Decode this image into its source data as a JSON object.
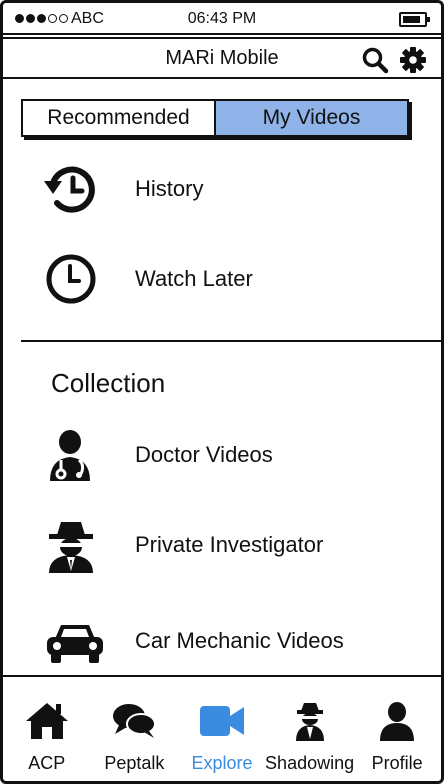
{
  "status_bar": {
    "carrier": "ABC",
    "time": "06:43 PM"
  },
  "header": {
    "title": "MARi Mobile",
    "search_icon": "search-icon",
    "settings_icon": "gear-icon"
  },
  "tabs": [
    {
      "label": "Recommended",
      "active": false
    },
    {
      "label": "My Videos",
      "active": true
    }
  ],
  "my_videos": [
    {
      "label": "History",
      "icon": "history-icon"
    },
    {
      "label": "Watch Later",
      "icon": "clock-icon"
    }
  ],
  "collection": {
    "title": "Collection",
    "items": [
      {
        "label": "Doctor Videos",
        "icon": "doctor-icon"
      },
      {
        "label": "Private Investigator",
        "icon": "detective-icon"
      },
      {
        "label": "Car Mechanic Videos",
        "icon": "car-icon"
      }
    ]
  },
  "bottom_nav": [
    {
      "label": "ACP",
      "icon": "home-icon"
    },
    {
      "label": "Peptalk",
      "icon": "chat-icon"
    },
    {
      "label": "Explore",
      "icon": "video-camera-icon",
      "active": true
    },
    {
      "label": "Shadowing",
      "icon": "detective-icon"
    },
    {
      "label": "Profile",
      "icon": "user-icon"
    }
  ],
  "colors": {
    "accent": "#3a8ce0",
    "tab_active": "#8fb3e8"
  }
}
